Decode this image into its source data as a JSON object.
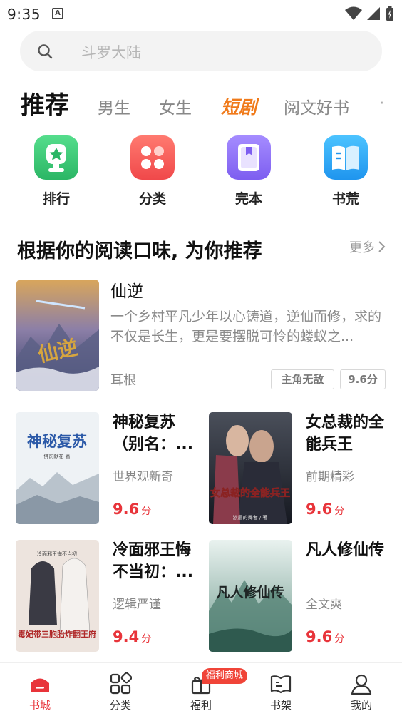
{
  "status_bar": {
    "time": "9:35",
    "notification_glyph": "A"
  },
  "search": {
    "placeholder": "斗罗大陆"
  },
  "tabs": [
    {
      "label": "推荐",
      "active": true
    },
    {
      "label": "男生"
    },
    {
      "label": "女生"
    },
    {
      "label": "短剧",
      "highlight": "#f07a1a"
    },
    {
      "label": "阅文好书"
    }
  ],
  "entries": [
    {
      "label": "排行",
      "icon": "trophy-icon",
      "color": "#3ec878"
    },
    {
      "label": "分类",
      "icon": "category-icon",
      "color": "#f25a5a"
    },
    {
      "label": "完本",
      "icon": "book-complete-icon",
      "color": "#8b6cf6"
    },
    {
      "label": "书荒",
      "icon": "open-book-icon",
      "color": "#2fa8f2"
    }
  ],
  "section": {
    "title": "根据你的阅读口味, 为你推荐",
    "more": "更多"
  },
  "featured": {
    "title": "仙逆",
    "desc": "一个乡村平凡少年以心铸道，逆仙而修，求的不仅是长生，更是要摆脱可怜的蝼蚁之...",
    "author": "耳根",
    "tags": [
      "主角无敌",
      "9.6分"
    ],
    "cover_text": "仙逆"
  },
  "books": [
    {
      "title": "神秘复苏（别名：...",
      "tag": "世界观新奇",
      "score": "9.6",
      "unit": "分",
      "cover_text": "神秘复苏",
      "cover_sub": "佛前献花 著"
    },
    {
      "title": "女总裁的全能兵王",
      "tag": "前期精彩",
      "score": "9.6",
      "unit": "分",
      "cover_text": "女总裁的全能兵王",
      "cover_sub": "浓眉的舞者 / 著"
    },
    {
      "title": "冷面邪王悔不当初：...",
      "tag": "逻辑严谨",
      "score": "9.4",
      "unit": "分",
      "cover_text": "毒妃带三胞胎炸翻王府",
      "cover_sub": "冷面邪王悔不当初"
    },
    {
      "title": "凡人修仙传",
      "tag": "全文爽",
      "score": "9.6",
      "unit": "分",
      "cover_text": "凡人修仙传"
    }
  ],
  "nav": {
    "items": [
      {
        "label": "书城",
        "active": true
      },
      {
        "label": "分类"
      },
      {
        "label": "福利"
      },
      {
        "label": "书架"
      },
      {
        "label": "我的"
      }
    ],
    "badge": "福利商城",
    "accent": "#e8343a"
  }
}
